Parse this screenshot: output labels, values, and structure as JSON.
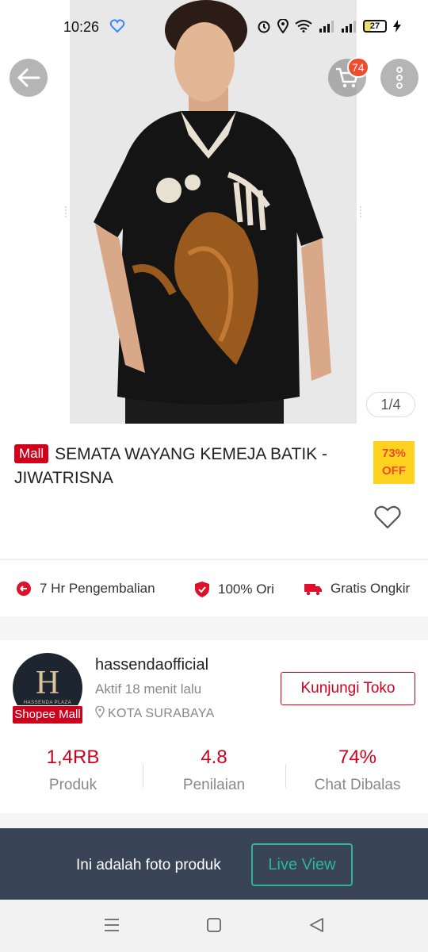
{
  "status_bar": {
    "time": "10:26",
    "battery": "27"
  },
  "header": {
    "cart_count": "74",
    "image_counter": "1/4"
  },
  "product": {
    "mall_badge": "Mall",
    "title": "SEMATA WAYANG KEMEJA BATIK - JIWATRISNA",
    "discount_percent": "73%",
    "discount_label": "OFF"
  },
  "guarantees": [
    {
      "icon": "return-icon",
      "label": "7 Hr Pengembalian"
    },
    {
      "icon": "shield-check-icon",
      "label": "100% Ori"
    },
    {
      "icon": "truck-icon",
      "label": "Gratis Ongkir"
    }
  ],
  "shop": {
    "name": "hassendaofficial",
    "active": "Aktif 18 menit lalu",
    "location": "KOTA SURABAYA",
    "badge": "Shopee Mall",
    "visit_label": "Kunjungi Toko",
    "logo_letter": "H",
    "logo_sub": "HASSENDA PLAZA",
    "stats": [
      {
        "value": "1,4RB",
        "label": "Produk"
      },
      {
        "value": "4.8",
        "label": "Penilaian"
      },
      {
        "value": "74%",
        "label": "Chat Dibalas"
      }
    ]
  },
  "live_bar": {
    "text": "Ini adalah foto produk",
    "button": "Live View"
  },
  "colors": {
    "brand_red": "#d0011b",
    "shopee_orange": "#ee4d2d",
    "live_teal": "#2bb5a0"
  }
}
